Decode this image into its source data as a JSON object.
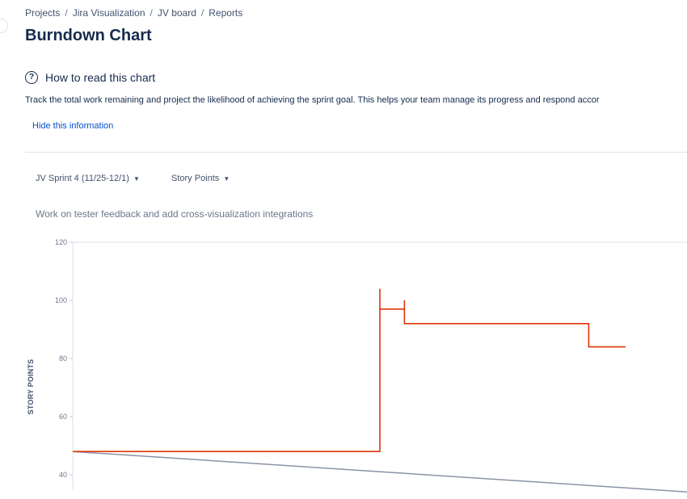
{
  "breadcrumbs": [
    "Projects",
    "Jira Visualization",
    "JV board",
    "Reports"
  ],
  "page_title": "Burndown Chart",
  "info": {
    "title": "How to read this chart",
    "icon": "question-circle-icon",
    "description": "Track the total work remaining and project the likelihood of achieving the sprint goal. This helps your team manage its progress and respond accor",
    "hide_link": "Hide this information"
  },
  "filters": {
    "sprint": "JV Sprint 4 (11/25-12/1)",
    "estimation": "Story Points"
  },
  "sprint_goal": "Work on tester feedback and add cross-visualization integrations",
  "colors": {
    "remaining": "#de350b",
    "guideline": "#8993a4",
    "link": "#0052cc",
    "text": "#172b4d"
  },
  "chart_data": {
    "type": "line",
    "ylabel": "STORY POINTS",
    "ylim": [
      35,
      120
    ],
    "yticks": [
      40,
      60,
      80,
      100,
      120
    ],
    "grid": false,
    "series": [
      {
        "role": "remaining-work",
        "step": true,
        "points": [
          [
            0,
            48
          ],
          [
            0.5,
            48
          ],
          [
            0.5,
            104
          ],
          [
            0.5,
            97
          ],
          [
            0.54,
            97
          ],
          [
            0.54,
            100
          ],
          [
            0.54,
            92
          ],
          [
            0.84,
            92
          ],
          [
            0.84,
            84
          ],
          [
            0.9,
            84
          ]
        ]
      },
      {
        "role": "guideline",
        "step": false,
        "points": [
          [
            0,
            48
          ],
          [
            1,
            34.1
          ]
        ]
      }
    ]
  }
}
